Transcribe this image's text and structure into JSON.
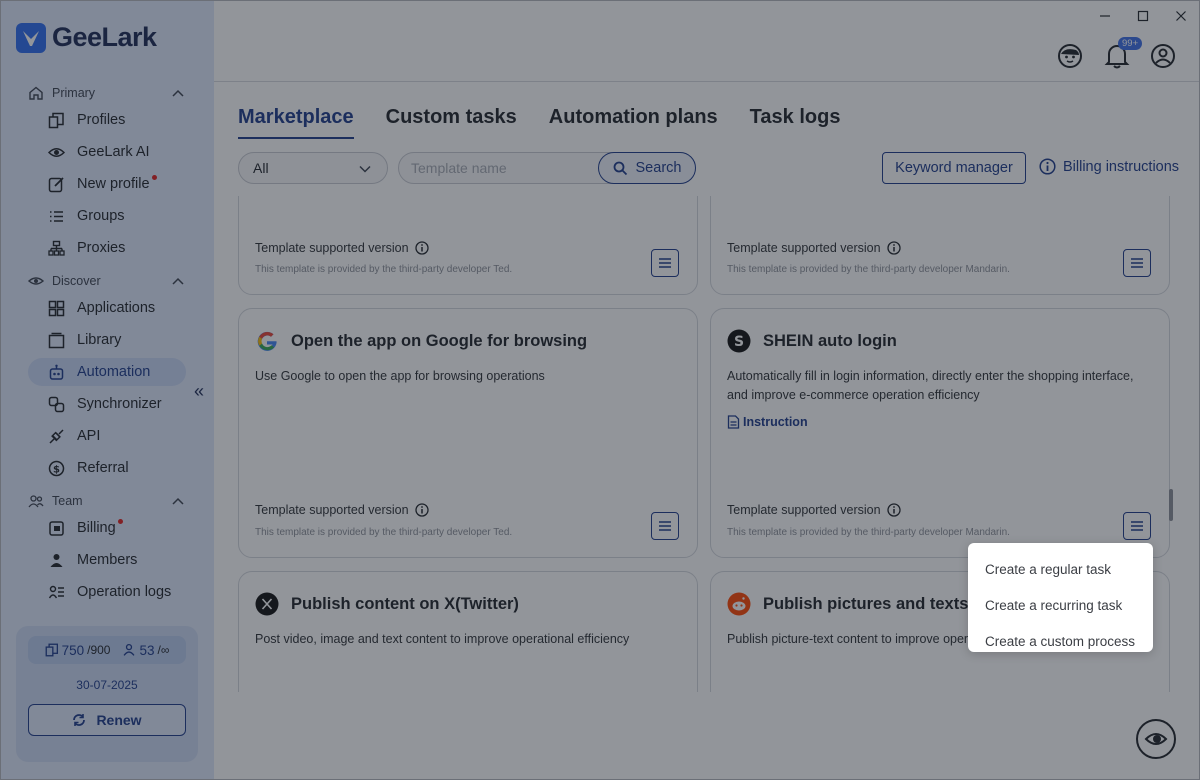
{
  "app": {
    "name": "GeeLark"
  },
  "window_controls": {
    "minimize": "minimize",
    "maximize": "maximize",
    "close": "close"
  },
  "header": {
    "notification_badge": "99+"
  },
  "sidebar": {
    "sections": [
      {
        "title": "Primary",
        "items": [
          "Profiles",
          "GeeLark AI",
          "New profile",
          "Groups",
          "Proxies"
        ]
      },
      {
        "title": "Discover",
        "items": [
          "Applications",
          "Library",
          "Automation",
          "Synchronizer",
          "API",
          "Referral"
        ]
      },
      {
        "title": "Team",
        "items": [
          "Billing",
          "Members",
          "Operation logs"
        ]
      }
    ],
    "active_item": "Automation",
    "quota": {
      "profiles_used": "750",
      "profiles_total": "/900",
      "members_used": "53",
      "members_total": "/∞"
    },
    "expiry_date": "30-07-2025",
    "renew_label": "Renew"
  },
  "tabs": [
    "Marketplace",
    "Custom tasks",
    "Automation plans",
    "Task logs"
  ],
  "active_tab": "Marketplace",
  "filters": {
    "category_value": "All",
    "search_placeholder": "Template name",
    "search_label": "Search",
    "keyword_manager_label": "Keyword manager",
    "billing_label": "Billing instructions"
  },
  "cards": [
    {
      "title": "",
      "description": "",
      "supported_version": "Template supported version",
      "provider": "This template is provided by the third-party developer Ted."
    },
    {
      "title": "",
      "description": "",
      "supported_version": "Template supported version",
      "provider": "This template is provided by the third-party developer Mandarin."
    },
    {
      "title": "Open the app on Google for browsing",
      "description": "Use Google to open the app for browsing operations",
      "supported_version": "Template supported version",
      "provider": "This template is provided by the third-party developer Ted."
    },
    {
      "title": "SHEIN auto login",
      "description": "Automatically fill in login information, directly enter the shopping interface, and improve e-commerce operation efficiency",
      "link": "Instruction",
      "supported_version": "Template supported version",
      "provider": "This template is provided by the third-party developer Mandarin."
    },
    {
      "title": "Publish content on X(Twitter)",
      "description": "Post video, image and text content to improve operational efficiency"
    },
    {
      "title": "Publish pictures and texts on",
      "description": "Publish picture-text content to improve opera"
    }
  ],
  "popup_menu": [
    "Create a regular task",
    "Create a recurring task",
    "Create a custom process"
  ],
  "colors": {
    "sidebar_bg": "#dfe8fb",
    "accent": "#1d3b8b",
    "brand": "#2d6cf0",
    "notify_dot": "#e02020"
  }
}
